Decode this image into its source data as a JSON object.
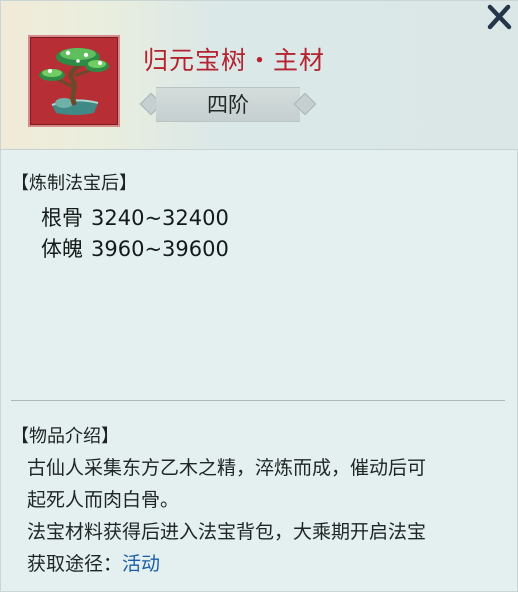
{
  "item": {
    "title": "归元宝树・主材",
    "grade": "四阶",
    "icon": "bonsai-tree-icon"
  },
  "refine_section": {
    "heading": "【炼制法宝后】",
    "stats": [
      {
        "name": "根骨",
        "range": "3240~32400"
      },
      {
        "name": "体魄",
        "range": "3960~39600"
      }
    ]
  },
  "intro_section": {
    "heading": "【物品介绍】",
    "lines": [
      "古仙人采集东方乙木之精，淬炼而成，催动后可",
      "起死人而肉白骨。",
      "法宝材料获得后进入法宝背包，大乘期开启法宝"
    ],
    "source_label": "获取途径：",
    "source_link": "活动"
  },
  "colors": {
    "title": "#b52330",
    "link": "#1a5ea8",
    "icon_bg": "#b72f35"
  }
}
